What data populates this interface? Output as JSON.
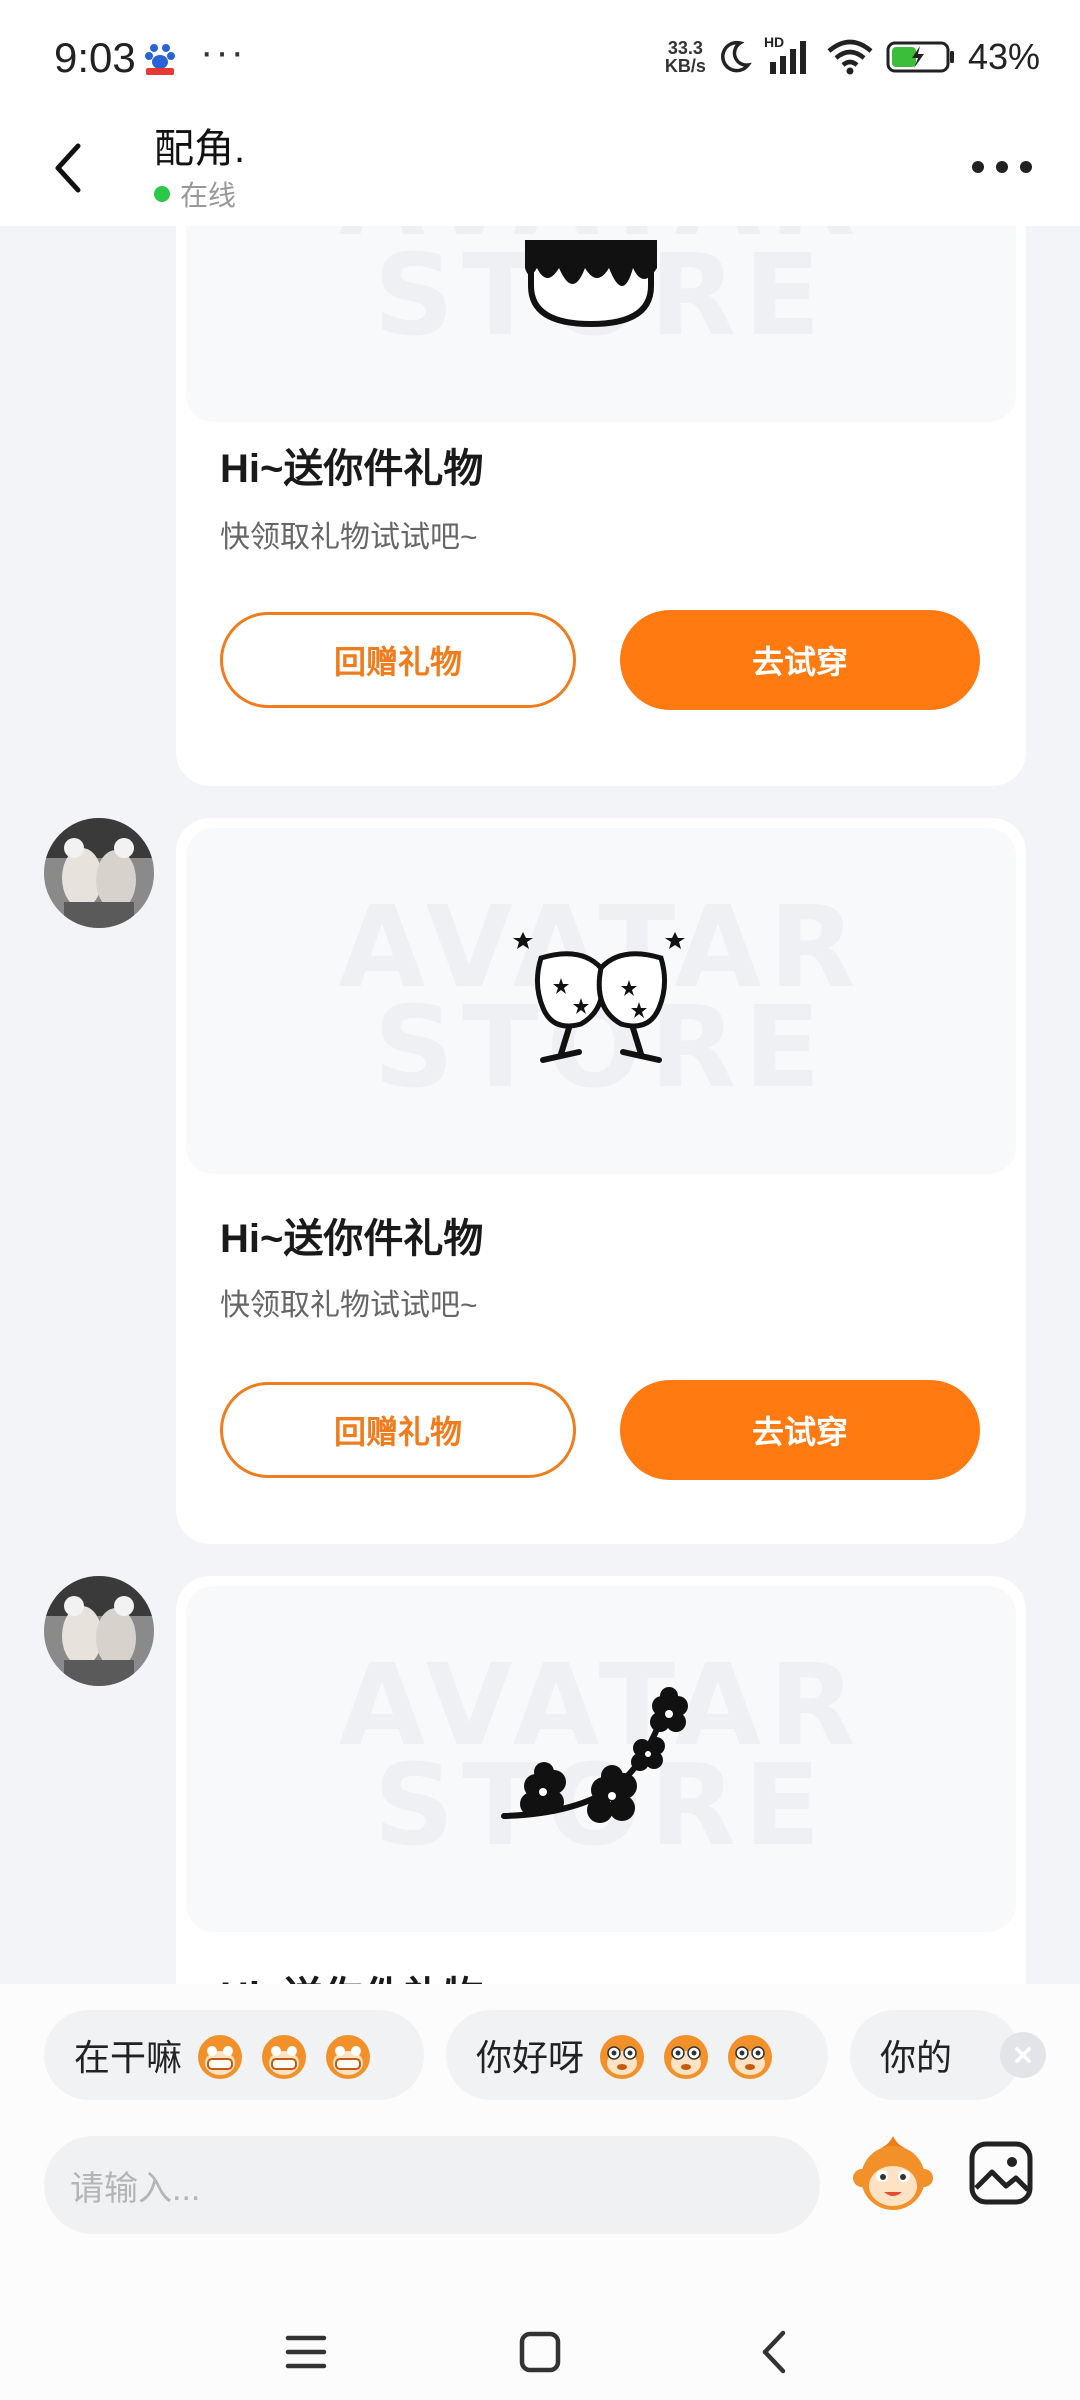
{
  "status_bar": {
    "time": "9:03",
    "more": "···",
    "net_speed_value": "33.3",
    "net_speed_unit": "KB/s",
    "network_label": "HD",
    "battery": "43%"
  },
  "header": {
    "name": "配角.",
    "status": "在线"
  },
  "gift_cards": [
    {
      "title": "Hi~送你件礼物",
      "subtitle": "快领取礼物试试吧~",
      "return_label": "回赠礼物",
      "try_label": "去试穿",
      "image": "cake-icon"
    },
    {
      "title": "Hi~送你件礼物",
      "subtitle": "快领取礼物试试吧~",
      "return_label": "回赠礼物",
      "try_label": "去试穿",
      "image": "wine-glasses-icon"
    },
    {
      "title": "Hi~送你件礼物",
      "image": "cherry-blossom-icon"
    }
  ],
  "watermark": {
    "line1": "AVATAR",
    "line2": "STORE"
  },
  "quick_replies": [
    {
      "label": "在干嘛",
      "emoji": "grinning-monkey-icon"
    },
    {
      "label": "你好呀",
      "emoji": "monkey-face-icon"
    },
    {
      "label": "你的"
    }
  ],
  "input": {
    "placeholder": "请输入..."
  },
  "colors": {
    "accent": "#ff7a10",
    "online": "#2cc84a",
    "background": "#f3f4f7"
  }
}
